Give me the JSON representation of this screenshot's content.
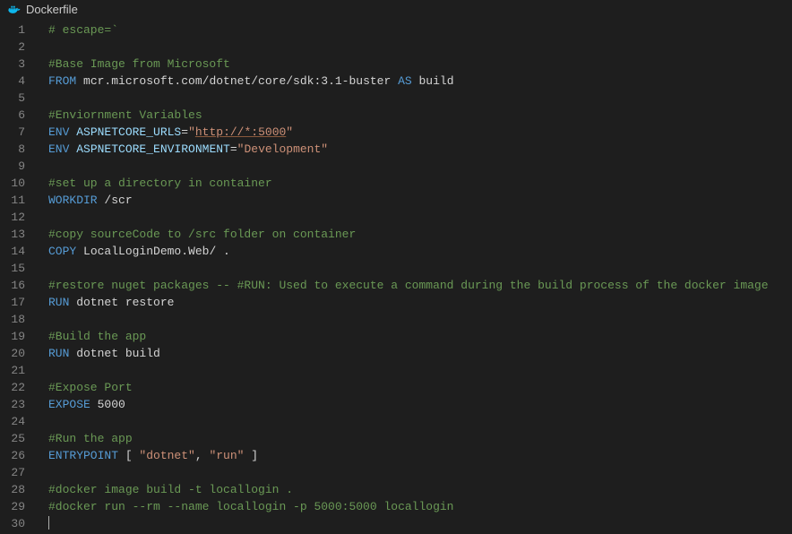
{
  "tab": {
    "filename": "Dockerfile",
    "icon": "docker-icon"
  },
  "code": {
    "lines": [
      [
        [
          "cm",
          "# escape=`"
        ]
      ],
      [],
      [
        [
          "cm",
          "#Base Image from Microsoft"
        ]
      ],
      [
        [
          "kw",
          "FROM"
        ],
        [
          "d",
          " mcr.microsoft.com/dotnet/core/sdk:3.1-buster "
        ],
        [
          "kw",
          "AS"
        ],
        [
          "d",
          " build"
        ]
      ],
      [],
      [
        [
          "cm",
          "#Enviornment Variables"
        ]
      ],
      [
        [
          "kw",
          "ENV"
        ],
        [
          "d",
          " "
        ],
        [
          "nm",
          "ASPNETCORE_URLS"
        ],
        [
          "d",
          "="
        ],
        [
          "st",
          "\""
        ],
        [
          "su",
          "http://*:5000"
        ],
        [
          "st",
          "\""
        ]
      ],
      [
        [
          "kw",
          "ENV"
        ],
        [
          "d",
          " "
        ],
        [
          "nm",
          "ASPNETCORE_ENVIRONMENT"
        ],
        [
          "d",
          "="
        ],
        [
          "st",
          "\"Development\""
        ]
      ],
      [],
      [
        [
          "cm",
          "#set up a directory in container"
        ]
      ],
      [
        [
          "kw",
          "WORKDIR"
        ],
        [
          "d",
          " /scr"
        ]
      ],
      [],
      [
        [
          "cm",
          "#copy sourceCode to /src folder on container"
        ]
      ],
      [
        [
          "kw",
          "COPY"
        ],
        [
          "d",
          " LocalLoginDemo.Web/ ."
        ]
      ],
      [],
      [
        [
          "cm",
          "#restore nuget packages -- #RUN: Used to execute a command during the build process of the docker image"
        ]
      ],
      [
        [
          "kw",
          "RUN"
        ],
        [
          "d",
          " dotnet restore"
        ]
      ],
      [],
      [
        [
          "cm",
          "#Build the app"
        ]
      ],
      [
        [
          "kw",
          "RUN"
        ],
        [
          "d",
          " dotnet build"
        ]
      ],
      [],
      [
        [
          "cm",
          "#Expose Port"
        ]
      ],
      [
        [
          "kw",
          "EXPOSE"
        ],
        [
          "d",
          " 5000"
        ]
      ],
      [],
      [
        [
          "cm",
          "#Run the app"
        ]
      ],
      [
        [
          "kw",
          "ENTRYPOINT"
        ],
        [
          "d",
          " [ "
        ],
        [
          "st",
          "\"dotnet\""
        ],
        [
          "d",
          ", "
        ],
        [
          "st",
          "\"run\""
        ],
        [
          "d",
          " ]"
        ]
      ],
      [],
      [
        [
          "cm",
          "#docker image build -t locallogin ."
        ]
      ],
      [
        [
          "cm",
          "#docker run --rm --name locallogin -p 5000:5000 locallogin"
        ]
      ],
      [
        [
          "caret",
          ""
        ]
      ]
    ]
  }
}
